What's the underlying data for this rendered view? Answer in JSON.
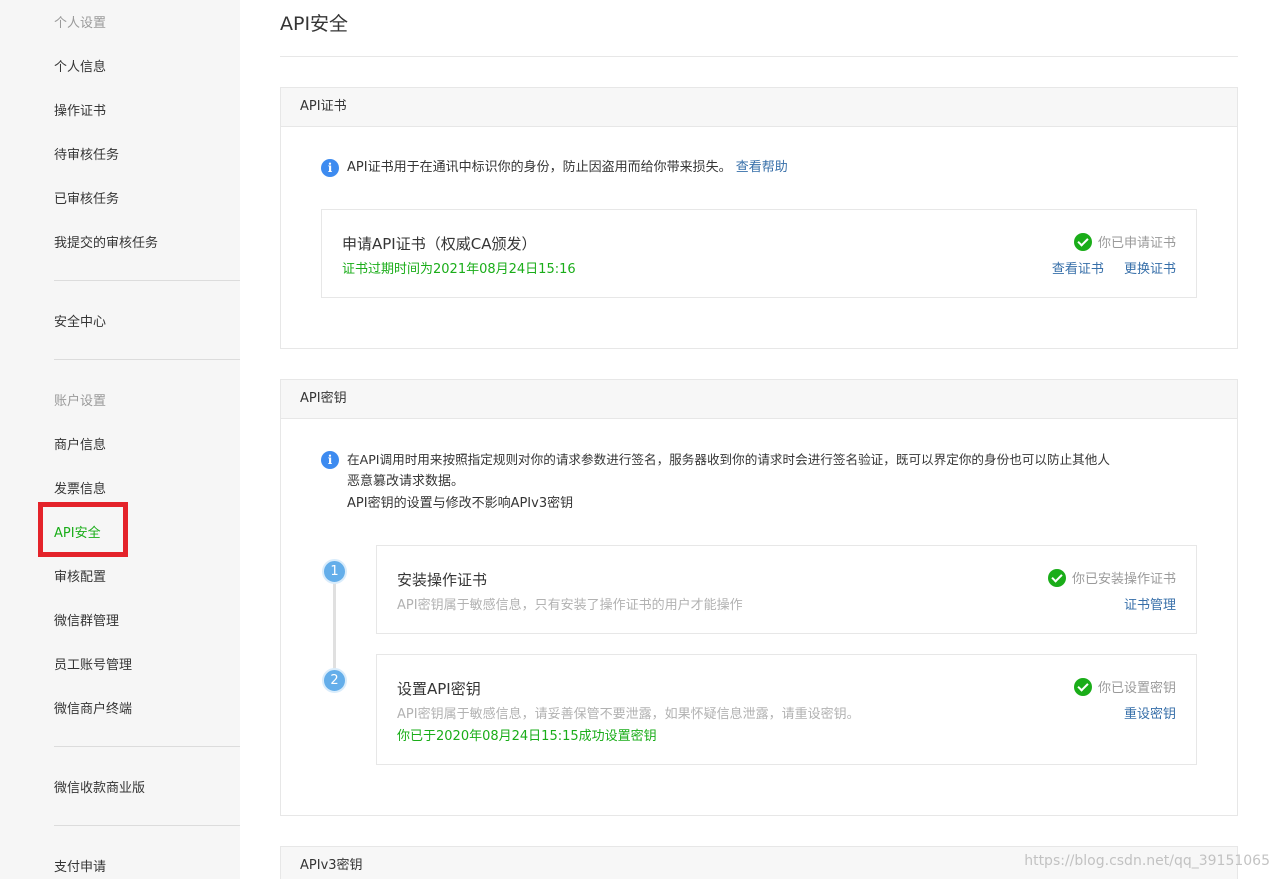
{
  "sidebar": {
    "group1_title": "个人设置",
    "personal_info": "个人信息",
    "operation_cert": "操作证书",
    "pending_review": "待审核任务",
    "reviewed": "已审核任务",
    "my_submitted": "我提交的审核任务",
    "security_center": "安全中心",
    "group2_title": "账户设置",
    "merchant_info": "商户信息",
    "invoice_info": "发票信息",
    "api_security": "API安全",
    "review_config": "审核配置",
    "wechat_group": "微信群管理",
    "staff_account": "员工账号管理",
    "wechat_terminal": "微信商户终端",
    "wechat_pay_biz": "微信收款商业版",
    "payment_apply": "支付申请"
  },
  "main": {
    "title": "API安全",
    "cert_panel": {
      "header": "API证书",
      "info": "API证书用于在通讯中标识你的身份，防止因盗用而给你带来损失。",
      "help_link": "查看帮助",
      "card": {
        "title": "申请API证书（权威CA颁发）",
        "expiry": "证书过期时间为2021年08月24日15:16",
        "status": "你已申请证书",
        "view_link": "查看证书",
        "replace_link": "更换证书"
      }
    },
    "key_panel": {
      "header": "API密钥",
      "info_line1": "在API调用时用来按照指定规则对你的请求参数进行签名，服务器收到你的请求时会进行签名验证，既可以界定你的身份也可以防止其他人",
      "info_line2": "恶意篡改请求数据。",
      "info_line3": "API密钥的设置与修改不影响APIv3密钥",
      "step1": {
        "num": "1",
        "title": "安装操作证书",
        "desc": "API密钥属于敏感信息，只有安装了操作证书的用户才能操作",
        "status": "你已安装操作证书",
        "link": "证书管理"
      },
      "step2": {
        "num": "2",
        "title": "设置API密钥",
        "desc": "API密钥属于敏感信息，请妥善保管不要泄露，如果怀疑信息泄露，请重设密钥。",
        "success": "你已于2020年08月24日15:15成功设置密钥",
        "status": "你已设置密钥",
        "link": "重设密钥"
      }
    },
    "v3_panel": {
      "header": "APIv3密钥"
    }
  },
  "watermark": "https://blog.csdn.net/qq_39151065",
  "colors": {
    "accent_green": "#1aad19",
    "link_blue": "#376fa9",
    "info_blue": "#3d8bf0",
    "highlight_red": "#e4232a"
  }
}
